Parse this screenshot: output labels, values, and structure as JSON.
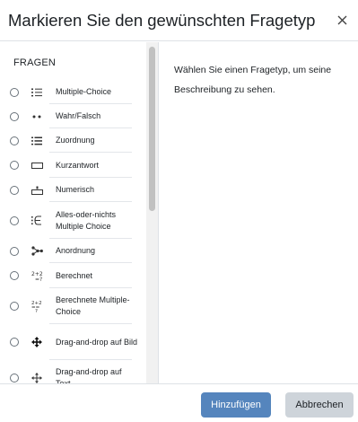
{
  "dialog": {
    "title": "Markieren Sie den gewünschten Fragetyp",
    "close_icon": "close-icon"
  },
  "sidebar": {
    "section_label": "FRAGEN",
    "items": [
      {
        "label": "Multiple-Choice",
        "icon": "list-icon"
      },
      {
        "label": "Wahr/Falsch",
        "icon": "two-dots-icon"
      },
      {
        "label": "Zuordnung",
        "icon": "grid-list-icon"
      },
      {
        "label": "Kurzantwort",
        "icon": "short-box-icon"
      },
      {
        "label": "Numerisch",
        "icon": "numeric-input-icon"
      },
      {
        "label": "Alles-oder-nichts Multiple Choice",
        "icon": "element-of-icon"
      },
      {
        "label": "Anordnung",
        "icon": "ordering-nodes-icon"
      },
      {
        "label": "Berechnet",
        "icon": "calculated-icon"
      },
      {
        "label": "Berechnete Multiple-Choice",
        "icon": "calculated-multi-icon"
      },
      {
        "label": "Drag-and-drop auf Bild",
        "icon": "move-arrows-icon"
      },
      {
        "label": "Drag-and-drop auf Text",
        "icon": "move-arrows-icon"
      }
    ]
  },
  "main": {
    "description": "Wählen Sie einen Fragetyp, um seine Beschreibung zu sehen."
  },
  "footer": {
    "add_label": "Hinzufügen",
    "cancel_label": "Abbrechen"
  },
  "colors": {
    "primary": "#5585bd",
    "secondary": "#ced4da",
    "text": "#1d2125"
  }
}
